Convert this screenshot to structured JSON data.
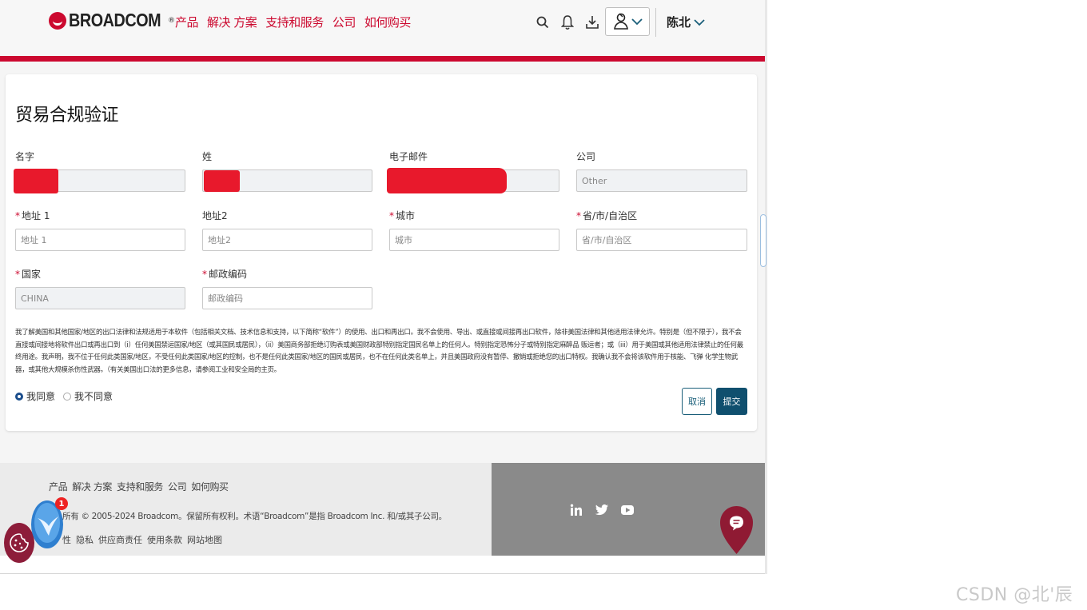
{
  "header": {
    "logo_text": "BROADCOM",
    "logo_reg": "®",
    "nav": [
      "产品",
      "解决 方案",
      "支持和服务",
      "公司",
      "如何购买"
    ],
    "username": "陈北",
    "icons": [
      "search-icon",
      "bell-icon",
      "download-icon",
      "user-avatar-icon",
      "chevron-down-icon"
    ]
  },
  "form": {
    "title": "贸易合规验证",
    "fields": {
      "first_name": {
        "label": "名字",
        "value": "",
        "required": false
      },
      "last_name": {
        "label": "姓",
        "value": "",
        "required": false
      },
      "email": {
        "label": "电子邮件",
        "value": "",
        "required": false
      },
      "company": {
        "label": "公司",
        "value": "Other",
        "required": false
      },
      "address1": {
        "label": "地址 1",
        "placeholder": "地址 1",
        "required": true
      },
      "address2": {
        "label": "地址2",
        "placeholder": "地址2",
        "required": false
      },
      "city": {
        "label": "城市",
        "placeholder": "城市",
        "required": true
      },
      "province": {
        "label": "省/市/自治区",
        "placeholder": "省/市/自治区",
        "required": true
      },
      "country": {
        "label": "国家",
        "value": "CHINA",
        "required": true
      },
      "postal": {
        "label": "邮政编码",
        "placeholder": "邮政编码",
        "required": true
      }
    },
    "required_mark": "*",
    "legal_text": "我了解美国和其他国家/地区的出口法律和法规适用于本软件（包括相关文档、技术信息和支持，以下简称“软件”）的使用、出口和再出口。我不会使用、导出、或直接或间接再出口软件，除非美国法律和其他适用法律允许。特别是（但不限于），我不会直接或间接地将软件出口或再出口到（i）任何美国禁运国家/地区（或其国民或居民），（ii）美国商务部拒绝订购表或美国财政部特别指定国民名单上的任何人。特别指定恐怖分子或特别指定麻醉品 贩运者；或（iii）用于美国或其他适用法律禁止的任何最终用途。我声明，我不位于任何此类国家/地区，不受任何此类国家/地区的控制，也不是任何此类国家/地区的国民或居民，也不在任何此类名单上，并且美国政府没有暂停、撤销或拒绝您的出口特权。我确认我不会将该软件用于核能、飞弹 化学生物武器，或其他大规模杀伤性武器。（有关美国出口法的更多信息，请参阅工业和安全局的主页。",
    "agree": "我同意",
    "disagree": "我不同意",
    "agree_selected": true,
    "cancel": "取消",
    "submit": "提交"
  },
  "footer": {
    "nav": [
      "产品",
      "解决 方案",
      "支持和服务",
      "公司",
      "如何购买"
    ],
    "copyright": "所有 © 2005-2024 Broadcom。保留所有权利。术语“Broadcom”是指 Broadcom Inc. 和/或其子公司。",
    "links": [
      "性",
      "隐私",
      "供应商责任",
      "使用条款",
      "网站地图"
    ],
    "social": [
      "linkedin-icon",
      "twitter-icon",
      "youtube-icon"
    ],
    "notification_count": "1"
  },
  "watermark": "CSDN @北'辰",
  "colors": {
    "brand_red": "#cc092f",
    "submit_blue": "#0f4f6e",
    "redaction": "#e8192c"
  }
}
